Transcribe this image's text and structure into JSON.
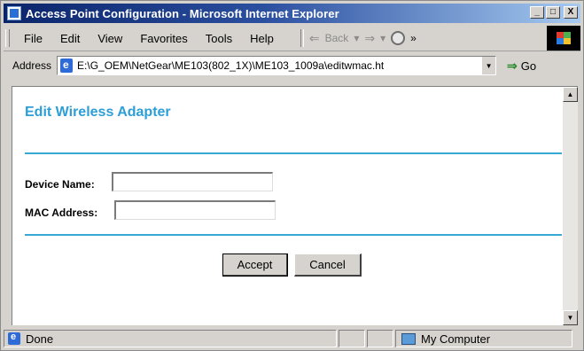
{
  "window": {
    "title": "Access Point Configuration - Microsoft Internet Explorer",
    "buttons": [
      "_",
      "□",
      "X"
    ]
  },
  "menu": {
    "items": [
      "File",
      "Edit",
      "View",
      "Favorites",
      "Tools",
      "Help"
    ],
    "back_label": "Back",
    "more": "»"
  },
  "address": {
    "label": "Address",
    "url": "E:\\G_OEM\\NetGear\\ME103(802_1X)\\ME103_1009a\\editwmac.ht",
    "go_label": "Go"
  },
  "page": {
    "title": "Edit Wireless Adapter",
    "device_name_label": "Device Name:",
    "device_name_value": "",
    "mac_address_label": "MAC Address:",
    "mac_address_value": "",
    "accept_label": "Accept",
    "cancel_label": "Cancel"
  },
  "status": {
    "text": "Done",
    "zone": "My Computer"
  },
  "colors": {
    "accent": "#2e9ed6",
    "rule": "#38a8d4",
    "titlebar_start": "#0a246a",
    "titlebar_end": "#a6caf0"
  }
}
